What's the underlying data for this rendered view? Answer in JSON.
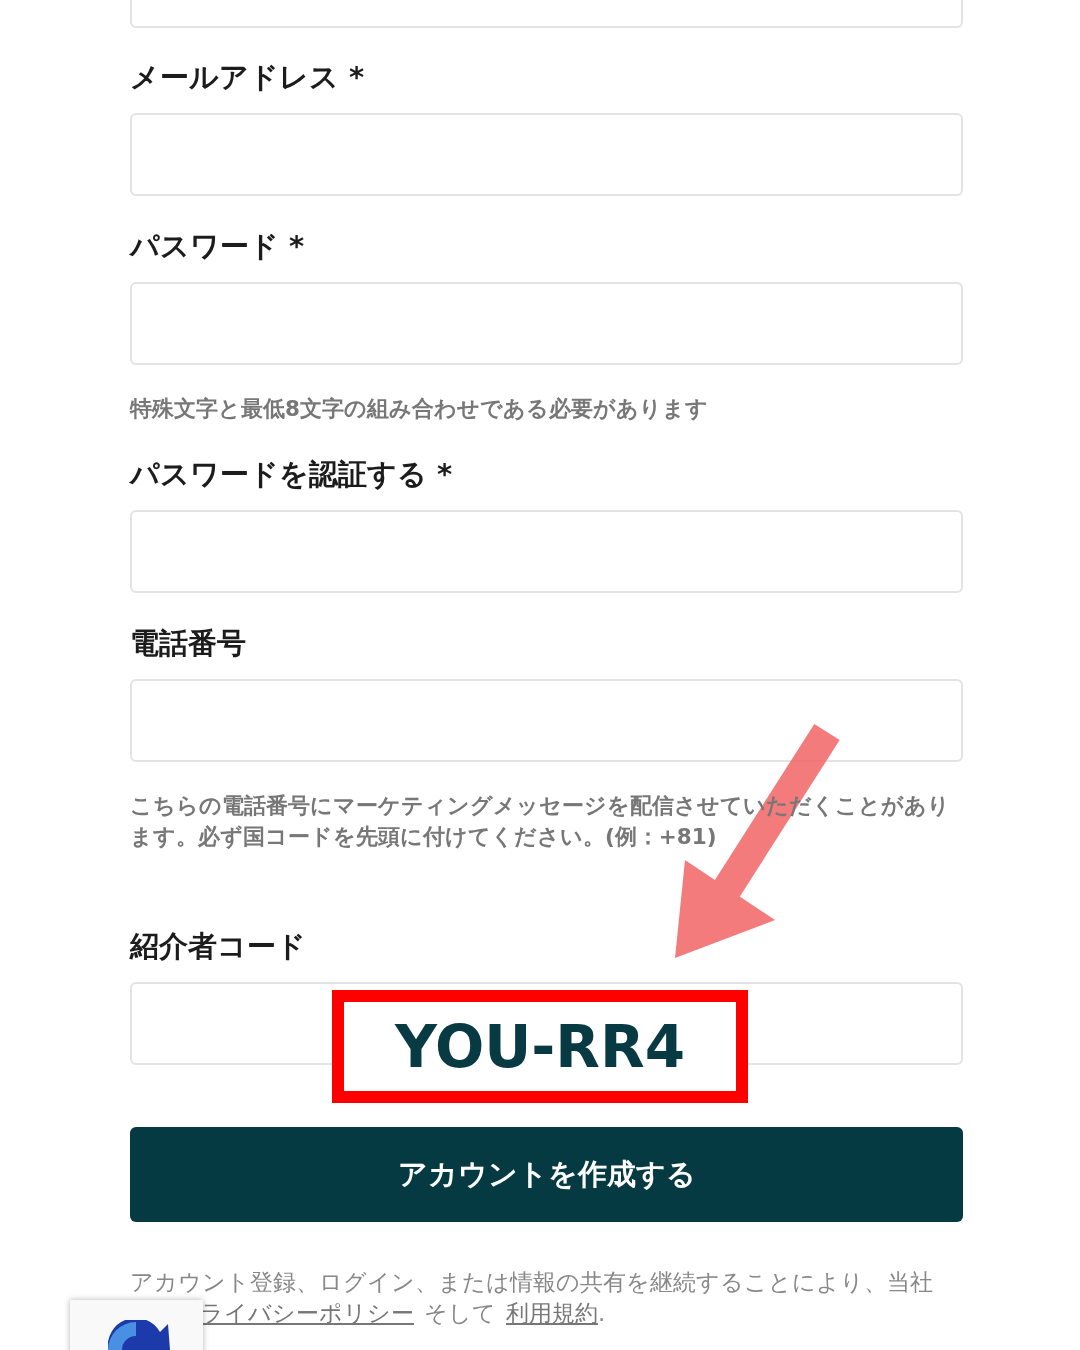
{
  "fields": [
    {
      "label": "メールアドレス *"
    },
    {
      "label": "パスワード *",
      "hint": "特殊文字と最低8文字の組み合わせである必要があります"
    },
    {
      "label": "パスワードを認証する *"
    },
    {
      "label": "電話番号",
      "hint": "こちらの電話番号にマーケティングメッセージを配信させていただくことがあります。必ず国コードを先頭に付けてください。(例：+81)"
    },
    {
      "label": "紹介者コード"
    }
  ],
  "submit_button": "アカウントを作成する",
  "consent": {
    "line_1": "アカウント登録、ログイン、または情報の共有を継続することにより、当社",
    "privacy_link": "ライバシーポリシー",
    "joiner": "そして",
    "terms_link": "利用規約",
    "end": "."
  },
  "annotation": {
    "code": "YOU-RR4"
  }
}
